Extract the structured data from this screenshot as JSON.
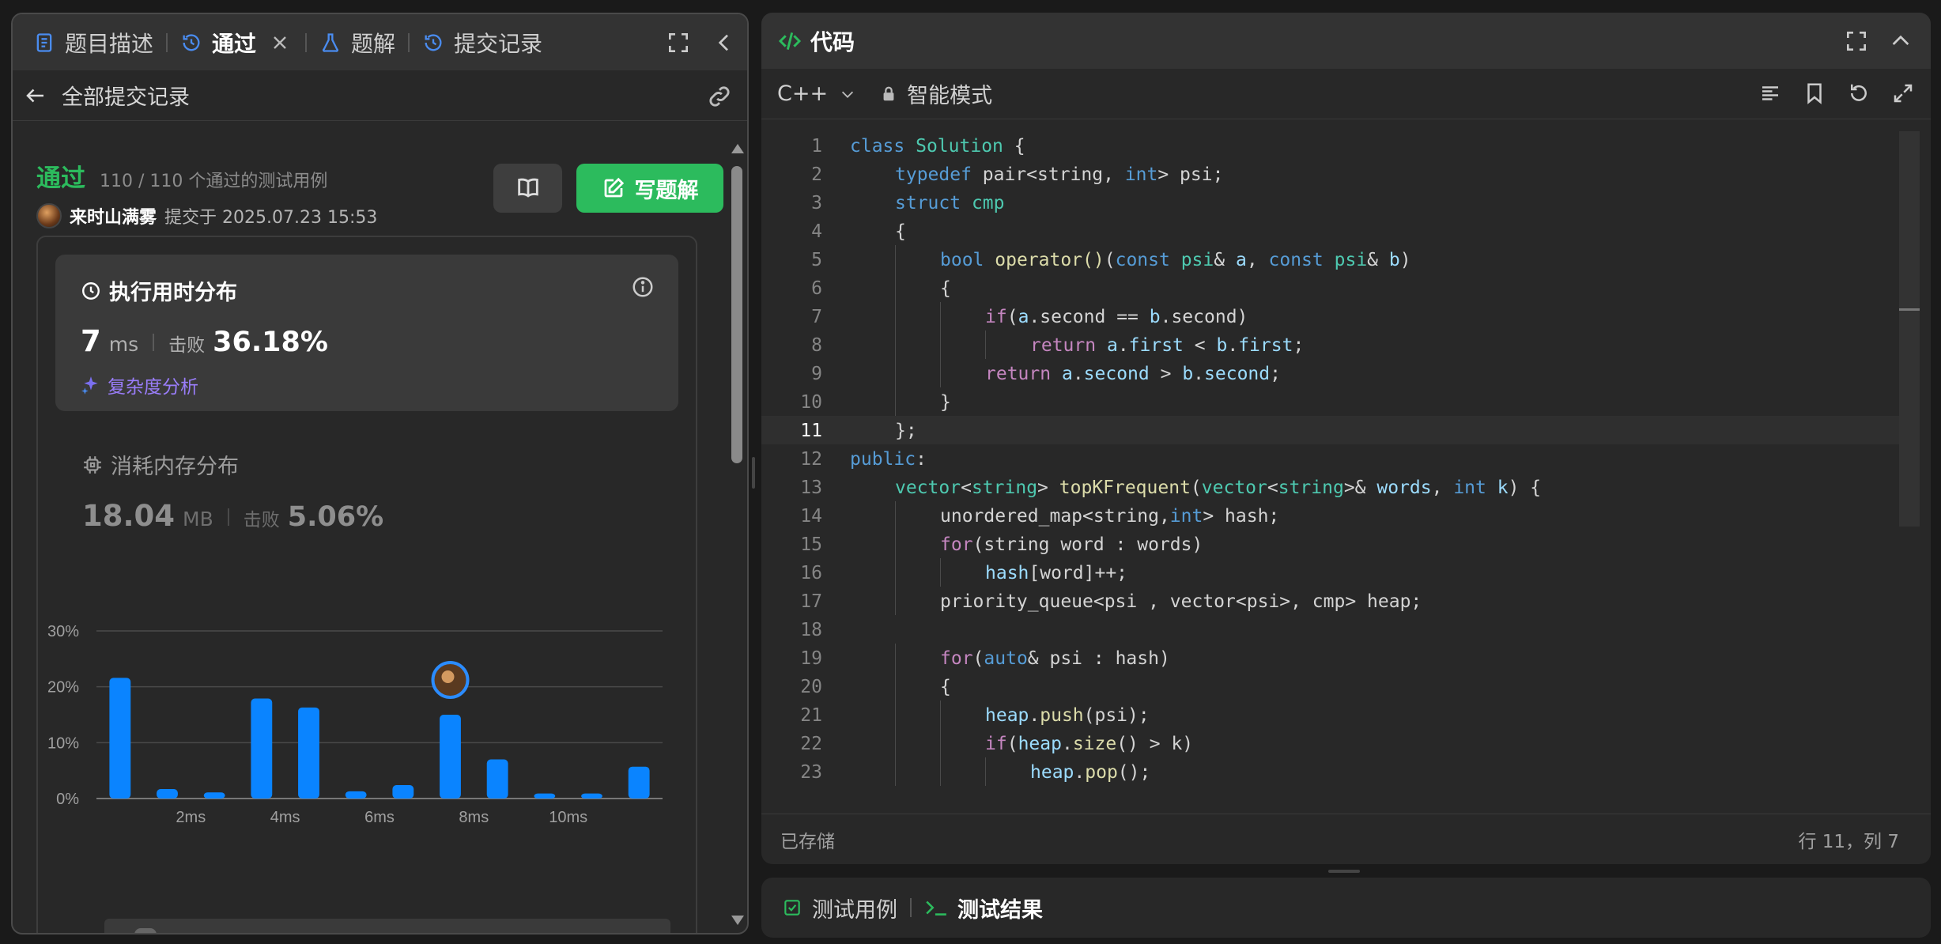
{
  "left_panel": {
    "tabs": [
      {
        "label": "题目描述",
        "icon": "document-icon"
      },
      {
        "label": "通过",
        "icon": "history-icon",
        "active": true
      },
      {
        "label": "题解",
        "icon": "flask-icon"
      },
      {
        "label": "提交记录",
        "icon": "history-icon"
      }
    ],
    "back_title": "全部提交记录",
    "status": "通过",
    "cases": "110 / 110 个通过的测试用例",
    "user": "来时山满雾",
    "submitted": "提交于 2025.07.23 15:53",
    "write_solution": "写题解",
    "runtime": {
      "title": "执行用时分布",
      "value": "7",
      "unit": "ms",
      "beat_label": "击败",
      "beat_pct": "36.18%",
      "complexity": "复杂度分析"
    },
    "memory": {
      "title": "消耗内存分布",
      "value": "18.04",
      "unit": "MB",
      "beat_label": "击败",
      "beat_pct": "5.06%"
    }
  },
  "chart_data": {
    "type": "bar",
    "xlabel": "",
    "ylabel": "",
    "y_ticks": [
      "30%",
      "20%",
      "10%",
      "0%"
    ],
    "x_ticks": [
      "2ms",
      "4ms",
      "6ms",
      "8ms",
      "10ms"
    ],
    "ylim": [
      0,
      30
    ],
    "x": [
      0.5,
      1.5,
      2.5,
      3.5,
      4.5,
      5.5,
      6.5,
      7.5,
      8.5,
      9.5,
      10.5,
      11.5
    ],
    "values": [
      21.6,
      1.7,
      1.1,
      17.9,
      16.3,
      1.3,
      2.4,
      15.0,
      7.0,
      0.9,
      0.9,
      5.7
    ],
    "highlight_x": 7.5,
    "color": "#0a84ff"
  },
  "editor": {
    "title": "代码",
    "language": "C++",
    "mode": "智能模式",
    "saved": "已存储",
    "cursor": "行 11，列 7",
    "current_line": 11,
    "lines": [
      {
        "n": "1",
        "indent": 0,
        "html": "<span class='kw'>class</span> <span class='ty'>Solution</span> {"
      },
      {
        "n": "2",
        "indent": 1,
        "html": "<span class='kw'>typedef</span> pair&lt;string, <span class='kw'>int</span>&gt; psi;"
      },
      {
        "n": "3",
        "indent": 1,
        "html": "<span class='kw'>struct</span> <span class='ty'>cmp</span>"
      },
      {
        "n": "4",
        "indent": 1,
        "html": "{"
      },
      {
        "n": "5",
        "indent": 2,
        "html": "<span class='kw'>bool</span> <span class='fn'>operator()</span>(<span class='kw'>const</span> <span class='ty'>psi</span>&amp; <span class='id'>a</span>, <span class='kw'>const</span> <span class='ty'>psi</span>&amp; <span class='id'>b</span>)"
      },
      {
        "n": "6",
        "indent": 2,
        "html": "{"
      },
      {
        "n": "7",
        "indent": 3,
        "html": "<span class='ct'>if</span>(<span class='id'>a</span>.second == <span class='id'>b</span>.second)"
      },
      {
        "n": "8",
        "indent": 4,
        "html": "<span class='ct'>return</span> <span class='id'>a</span>.<span class='id'>first</span> &lt; <span class='id'>b</span>.<span class='id'>first</span>;"
      },
      {
        "n": "9",
        "indent": 3,
        "html": "<span class='ct'>return</span> <span class='id'>a</span>.<span class='id'>second</span> &gt; <span class='id'>b</span>.<span class='id'>second</span>;"
      },
      {
        "n": "10",
        "indent": 2,
        "html": "}"
      },
      {
        "n": "11",
        "indent": 1,
        "html": "};"
      },
      {
        "n": "12",
        "indent": 0,
        "html": "<span class='kw'>public</span>:"
      },
      {
        "n": "13",
        "indent": 1,
        "html": "<span class='ty'>vector</span>&lt;<span class='ty'>string</span>&gt; <span class='fn'>topKFrequent</span>(<span class='ty'>vector</span>&lt;<span class='ty'>string</span>&gt;&amp; <span class='id'>words</span>, <span class='kw'>int</span> <span class='id'>k</span>) {"
      },
      {
        "n": "14",
        "indent": 2,
        "html": "unordered_map&lt;string,<span class='kw'>int</span>&gt; hash;"
      },
      {
        "n": "15",
        "indent": 2,
        "html": "<span class='ct'>for</span>(string word : words)"
      },
      {
        "n": "16",
        "indent": 3,
        "html": "<span class='id'>hash</span>[word]++;"
      },
      {
        "n": "17",
        "indent": 2,
        "html": "priority_queue&lt;psi , vector&lt;psi&gt;, cmp&gt; heap;"
      },
      {
        "n": "18",
        "indent": 0,
        "html": ""
      },
      {
        "n": "19",
        "indent": 2,
        "html": "<span class='ct'>for</span>(<span class='kw'>auto</span>&amp; psi : hash)"
      },
      {
        "n": "20",
        "indent": 2,
        "html": "{"
      },
      {
        "n": "21",
        "indent": 3,
        "html": "<span class='id'>heap</span>.<span class='fn'>push</span>(psi);"
      },
      {
        "n": "22",
        "indent": 3,
        "html": "<span class='ct'>if</span>(<span class='id'>heap</span>.<span class='fn'>size</span>() &gt; k)"
      },
      {
        "n": "23",
        "indent": 4,
        "html": "<span class='id'>heap</span>.<span class='fn'>pop</span>();"
      }
    ]
  },
  "bottom_panel": {
    "tabs": [
      {
        "label": "测试用例",
        "icon": "checkbox-icon"
      },
      {
        "label": "测试结果",
        "icon": "terminal-icon",
        "active": true
      }
    ]
  }
}
